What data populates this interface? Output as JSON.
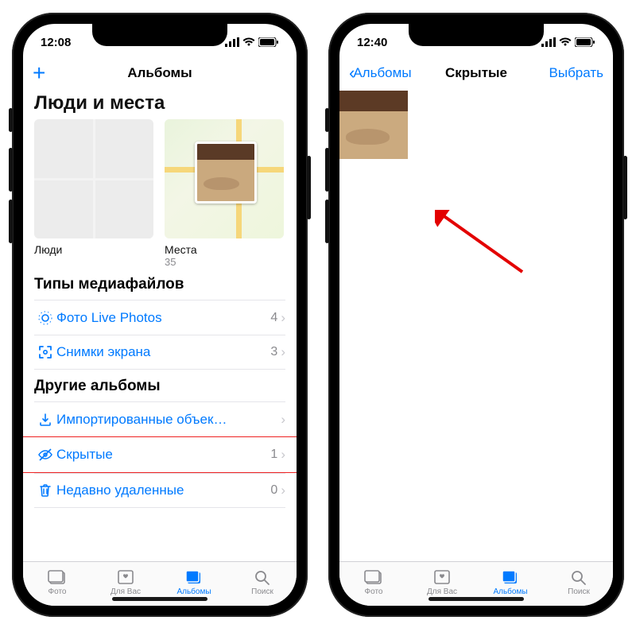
{
  "left": {
    "status_time": "12:08",
    "nav_title": "Альбомы",
    "clipped_header": "Люди и места",
    "albums": [
      {
        "label": "Люди",
        "count": ""
      },
      {
        "label": "Места",
        "count": "35"
      }
    ],
    "section_media": "Типы медиафайлов",
    "media_rows": [
      {
        "label": "Фото Live Photos",
        "count": "4"
      },
      {
        "label": "Снимки экрана",
        "count": "3"
      }
    ],
    "section_other": "Другие альбомы",
    "other_rows": [
      {
        "label": "Импортированные объек…",
        "count": ""
      },
      {
        "label": "Скрытые",
        "count": "1"
      },
      {
        "label": "Недавно удаленные",
        "count": "0"
      }
    ]
  },
  "right": {
    "status_time": "12:40",
    "back_label": "Альбомы",
    "nav_title": "Скрытые",
    "select_label": "Выбрать"
  },
  "tabs": [
    {
      "label": "Фото"
    },
    {
      "label": "Для Вас"
    },
    {
      "label": "Альбомы"
    },
    {
      "label": "Поиск"
    }
  ]
}
